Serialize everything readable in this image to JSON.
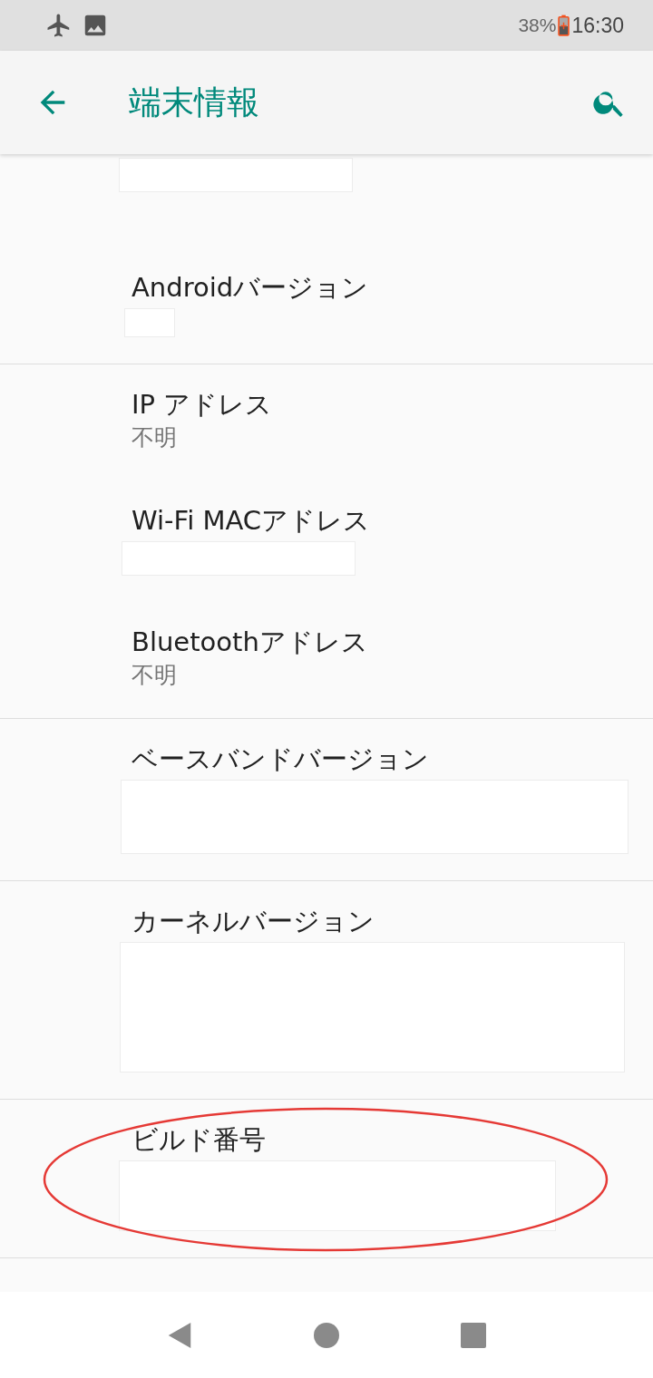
{
  "status_bar": {
    "battery": "38%",
    "time": "16:30"
  },
  "app_bar": {
    "title": "端末情報"
  },
  "groups": [
    {
      "items": [
        {
          "redacted": true
        },
        {
          "title": "Androidバージョン",
          "redacted": true
        }
      ]
    },
    {
      "items": [
        {
          "title": "IP アドレス",
          "summary": "不明"
        },
        {
          "title": "Wi-Fi MACアドレス",
          "redacted": true
        },
        {
          "title": "Bluetoothアドレス",
          "summary": "不明"
        }
      ]
    },
    {
      "items": [
        {
          "title": "ベースバンドバージョン",
          "redacted": true
        }
      ]
    },
    {
      "items": [
        {
          "title": "カーネルバージョン",
          "redacted": true
        }
      ]
    },
    {
      "items": [
        {
          "title": "ビルド番号",
          "redacted": true,
          "highlighted": true
        }
      ]
    }
  ]
}
